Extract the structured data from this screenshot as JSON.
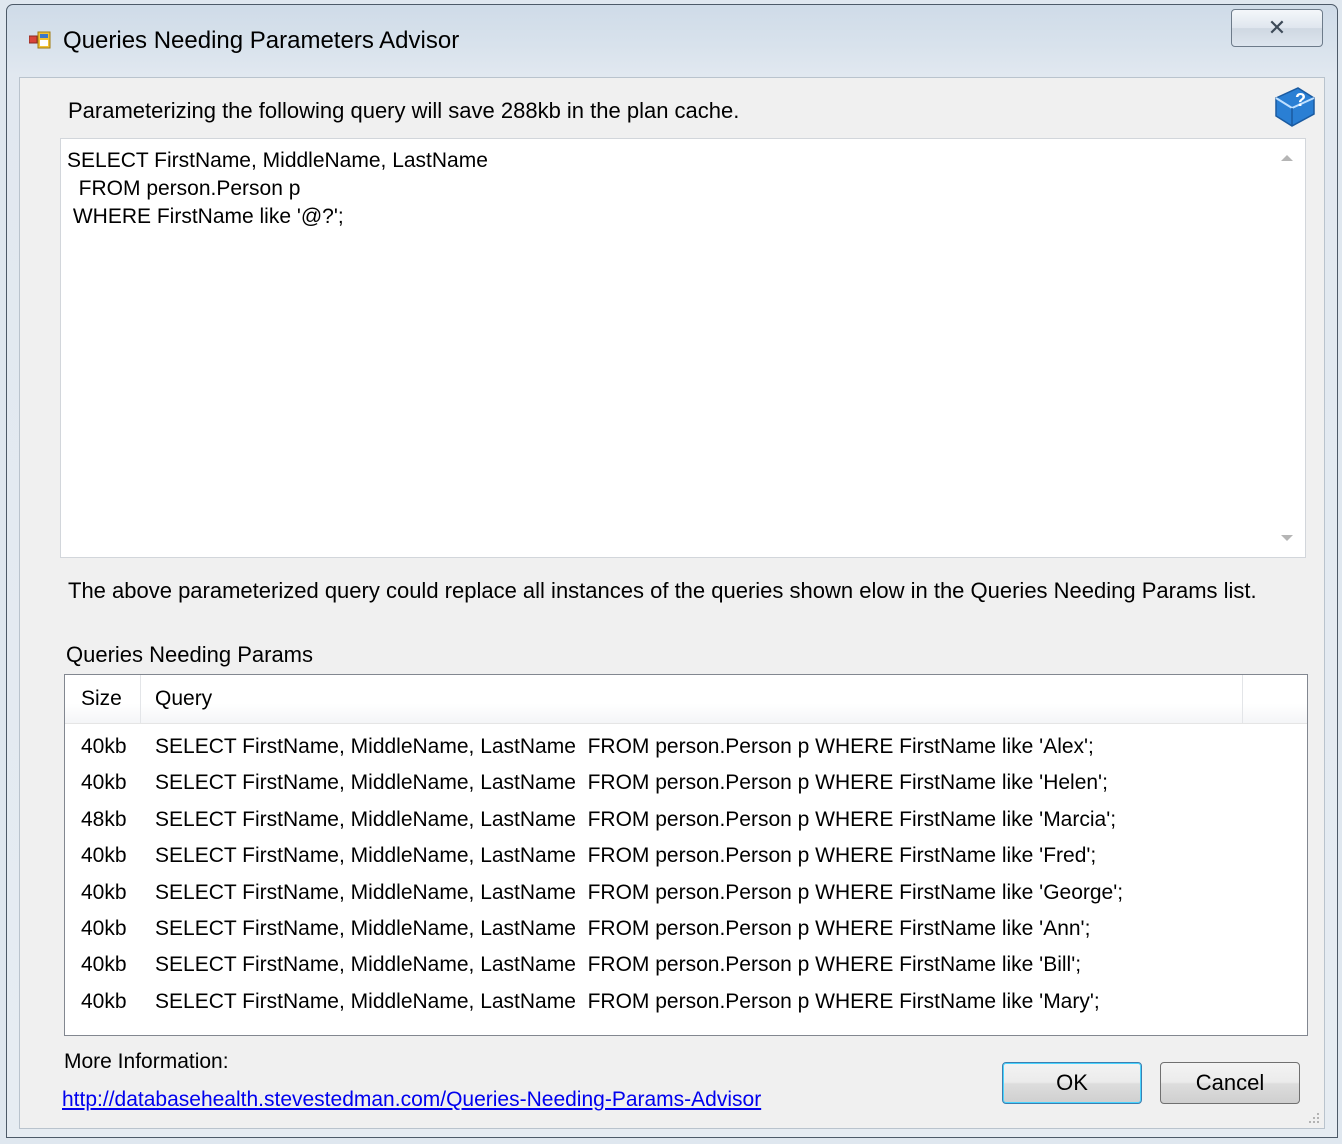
{
  "window": {
    "title": "Queries Needing Parameters Advisor",
    "close_glyph": "✕"
  },
  "dialog": {
    "summary": "Parameterizing the following query will save 288kb in the plan cache.",
    "query_text": "SELECT FirstName, MiddleName, LastName\n  FROM person.Person p\n WHERE FirstName like '@?';",
    "replace_note": "The above parameterized query could replace all instances of the queries shown elow in the Queries Needing Params list.",
    "list_label": "Queries Needing Params",
    "columns": {
      "size": "Size",
      "query": "Query"
    },
    "rows": [
      {
        "size": "40kb",
        "query": "SELECT FirstName, MiddleName, LastName  FROM person.Person p WHERE FirstName like 'Alex';"
      },
      {
        "size": "40kb",
        "query": "SELECT FirstName, MiddleName, LastName  FROM person.Person p WHERE FirstName like 'Helen';"
      },
      {
        "size": "48kb",
        "query": "SELECT FirstName, MiddleName, LastName  FROM person.Person p WHERE FirstName like 'Marcia';"
      },
      {
        "size": "40kb",
        "query": "SELECT FirstName, MiddleName, LastName  FROM person.Person p WHERE FirstName like 'Fred';"
      },
      {
        "size": "40kb",
        "query": "SELECT FirstName, MiddleName, LastName  FROM person.Person p WHERE FirstName like 'George';"
      },
      {
        "size": "40kb",
        "query": "SELECT FirstName, MiddleName, LastName  FROM person.Person p WHERE FirstName like 'Ann';"
      },
      {
        "size": "40kb",
        "query": "SELECT FirstName, MiddleName, LastName  FROM person.Person p WHERE FirstName like 'Bill';"
      },
      {
        "size": "40kb",
        "query": "SELECT FirstName, MiddleName, LastName  FROM person.Person p WHERE FirstName like 'Mary';"
      }
    ],
    "more_info_label": "More Information:",
    "more_info_link": "http://databasehealth.stevestedman.com/Queries-Needing-Params-Advisor",
    "ok_label": "OK",
    "cancel_label": "Cancel"
  },
  "icons": {
    "app": "app-window-icon",
    "help": "help-book-icon",
    "close": "close-icon",
    "grip": "resize-grip-icon"
  },
  "colors": {
    "link": "#0000ee",
    "window_frame": "#d8e2ec",
    "client_bg": "#f0f0f0",
    "default_button_border": "#3c7fb1"
  }
}
